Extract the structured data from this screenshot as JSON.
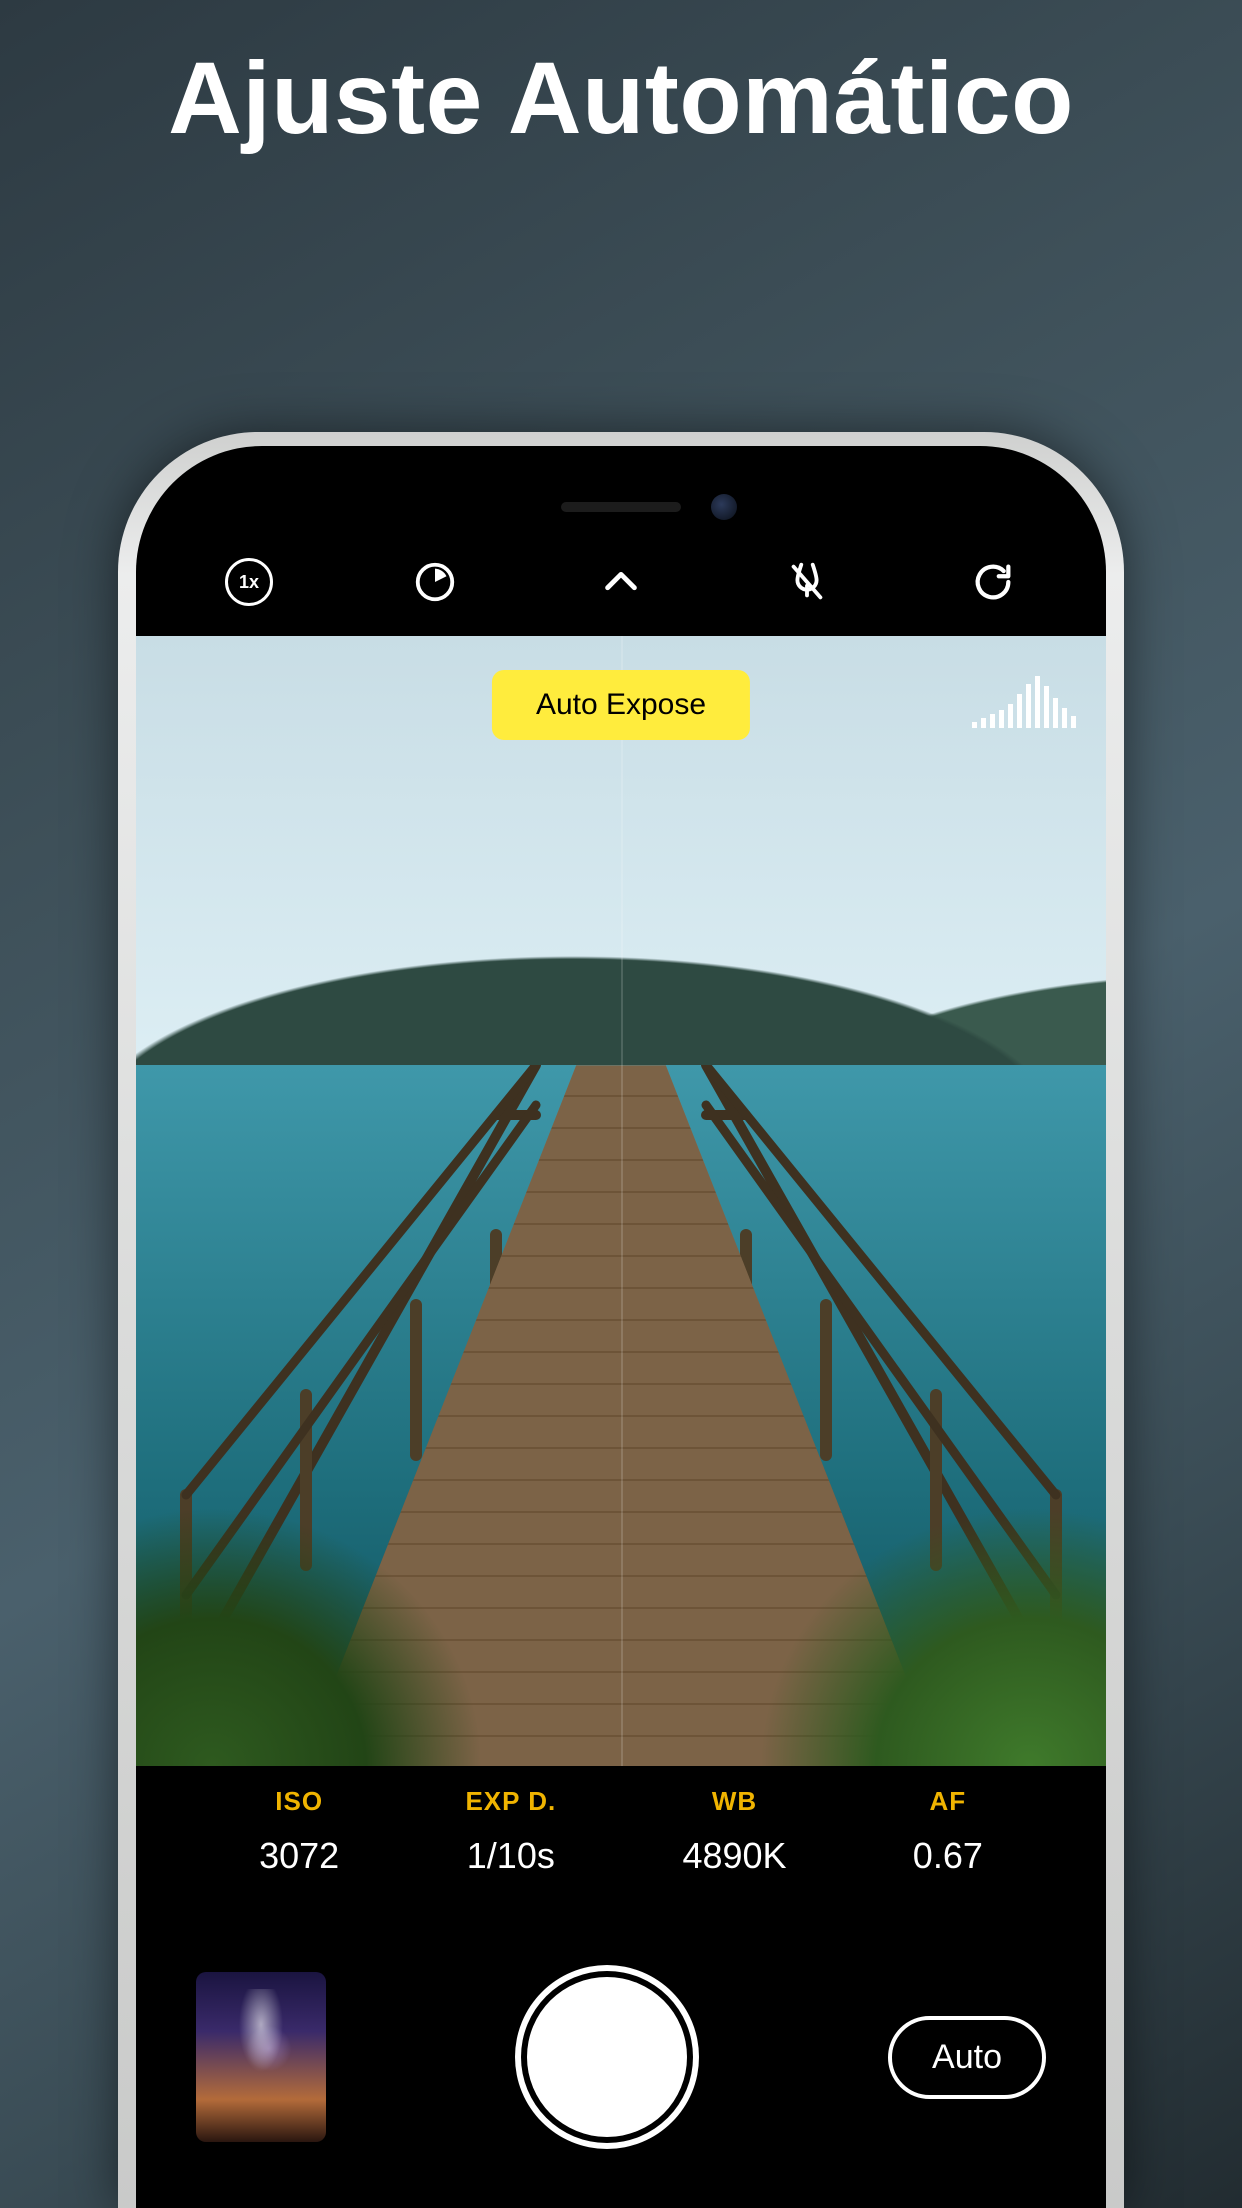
{
  "headline": "Ajuste Automático",
  "topbar": {
    "zoom_label": "1x"
  },
  "viewfinder": {
    "badge_label": "Auto Expose"
  },
  "params": [
    {
      "label": "ISO",
      "value": "3072"
    },
    {
      "label": "EXP D.",
      "value": "1/10s"
    },
    {
      "label": "WB",
      "value": "4890K"
    },
    {
      "label": "AF",
      "value": "0.67"
    }
  ],
  "bottombar": {
    "mode_label": "Auto"
  },
  "histogram_bars": [
    6,
    10,
    14,
    18,
    24,
    34,
    44,
    52,
    42,
    30,
    20,
    12
  ]
}
